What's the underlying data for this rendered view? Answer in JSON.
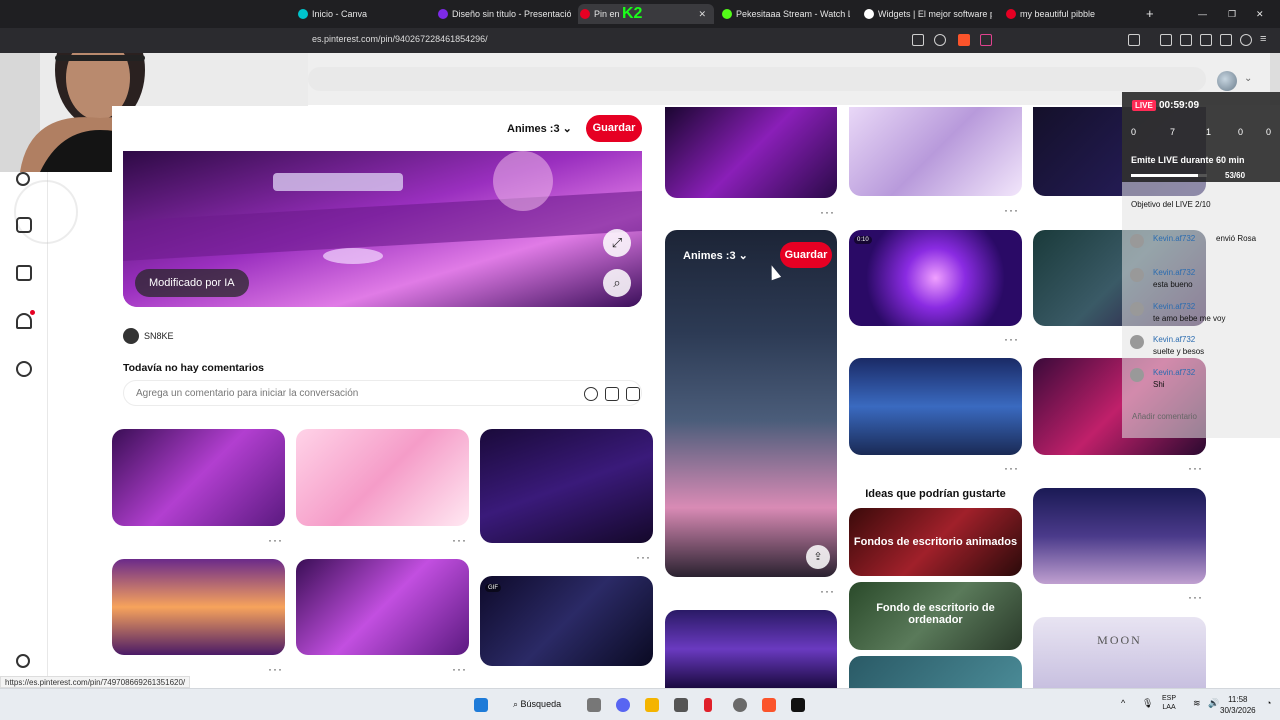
{
  "tabs": [
    {
      "label": "Inicio - Canva",
      "color": "#00c4cc"
    },
    {
      "label": "Diseño sin título - Presentación",
      "color": "#7d2ae8"
    },
    {
      "label": "Pin en",
      "color": "#e60023",
      "active": true
    },
    {
      "label": "Pekesitaaa Stream - Watch Live",
      "color": "#53fc18"
    },
    {
      "label": "Widgets | El mejor software pa",
      "color": "#ffffff"
    },
    {
      "label": "my beautiful pibble",
      "color": "#e60023"
    }
  ],
  "overlay_text": "K2",
  "address": {
    "url": "es.pinterest.com/pin/940267228461854296/"
  },
  "pin": {
    "board_name": "Animes :3",
    "save_label": "Guardar",
    "ai_badge": "Modificado por IA",
    "author": "SN8KE",
    "comments_heading": "Todavía no hay comentarios",
    "comment_placeholder": "Agrega un comentario para iniciar la conversación"
  },
  "hover_pin": {
    "board_name": "Animes :3",
    "save_label": "Guardar"
  },
  "grid": {
    "ideas_heading": "Ideas que podrían gustarte",
    "idea1": "Fondos de escritorio animados",
    "idea2": "Fondo de escritorio de ordenador",
    "moon_label": "MOON",
    "gif_badge": "GIF",
    "video_time": "0:10",
    "more": "···"
  },
  "live": {
    "badge": "LIVE",
    "time": "00:59:09",
    "stats": [
      "0",
      "7",
      "1",
      "0",
      "0"
    ],
    "goal_title": "Emite LIVE durante 60 min",
    "goal_count": "53/60",
    "goal_progress": 0.883,
    "objective": "Objetivo del LIVE 2/10",
    "chat": [
      {
        "name": "Kevin.af732",
        "msg": "envió Rosa"
      },
      {
        "name": "Kevin.af732",
        "msg": "esta bueno"
      },
      {
        "name": "Kevin.af732",
        "msg": "te amo bebe me voy"
      },
      {
        "name": "Kevin.af732",
        "msg": "suelte y besos"
      },
      {
        "name": "Kevin.af732",
        "msg": "Shi"
      }
    ],
    "add_comment": "Añadir comentario"
  },
  "status_url": "https://es.pinterest.com/pin/749708669261351620/",
  "taskbar": {
    "search_label": "Búsqueda",
    "lang": "ESP",
    "lang2": "LAA",
    "time": "11:58",
    "date": "30/3/2026"
  },
  "colors": {
    "brand": "#e60023",
    "live": "#ff2a55"
  }
}
